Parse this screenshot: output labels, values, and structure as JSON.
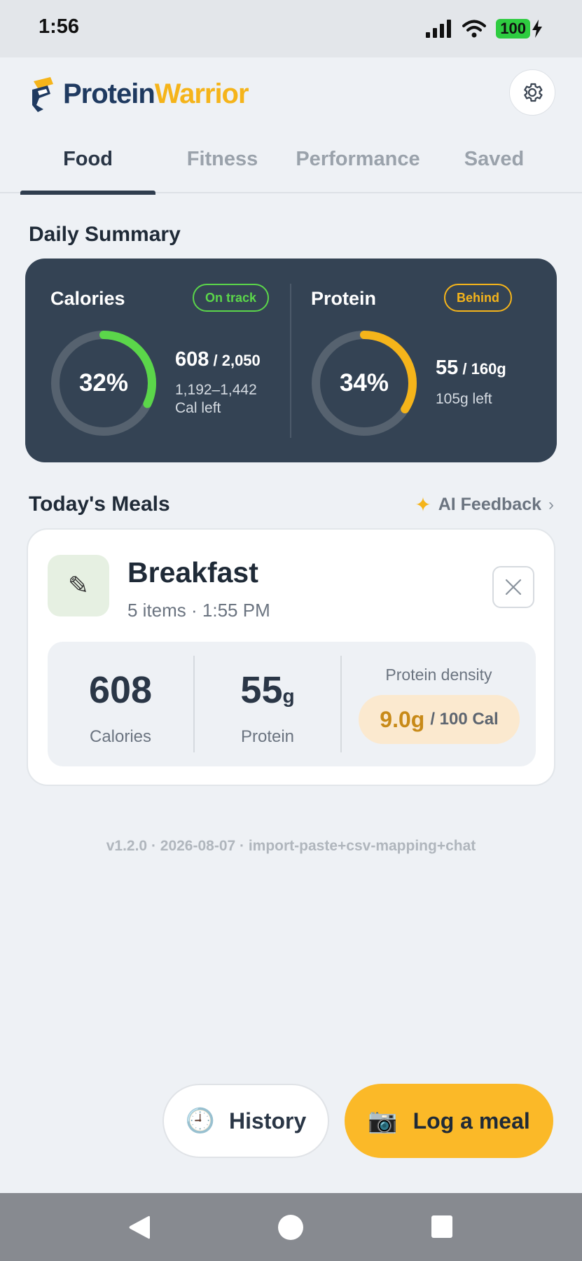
{
  "status_bar": {
    "time": "1:56",
    "battery": "100"
  },
  "app": {
    "name_part1": "Protein",
    "name_part2": "Warrior"
  },
  "tabs": [
    "Food",
    "Fitness",
    "Performance",
    "Saved"
  ],
  "active_tab": "Food",
  "daily_summary": {
    "title": "Daily Summary",
    "calories": {
      "label": "Calories",
      "status": "On track",
      "percent": "32%",
      "progress_fraction": 0.32,
      "consumed": "608",
      "goal": " / 2,050",
      "remaining_line1": "1,192–1,442",
      "remaining_line2": "Cal left",
      "color": "#5bd64a"
    },
    "protein": {
      "label": "Protein",
      "status": "Behind",
      "percent": "34%",
      "progress_fraction": 0.34,
      "consumed": "55",
      "goal": " / 160g",
      "remaining_line1": "105g left",
      "color": "#f5b41a"
    }
  },
  "meals": {
    "title": "Today's Meals",
    "ai_feedback": "AI Feedback",
    "items": [
      {
        "name": "Breakfast",
        "subtitle": "5 items · 1:55 PM",
        "calories": "608",
        "calories_label": "Calories",
        "protein": "55",
        "protein_unit": "g",
        "protein_label": "Protein",
        "density_label": "Protein density",
        "density_value": "9.0g",
        "density_unit": "/ 100 Cal"
      }
    ]
  },
  "version": "v1.2.0 · 2026-08-07 · import-paste+csv-mapping+chat",
  "actions": {
    "history": "History",
    "log_meal": "Log a meal"
  }
}
